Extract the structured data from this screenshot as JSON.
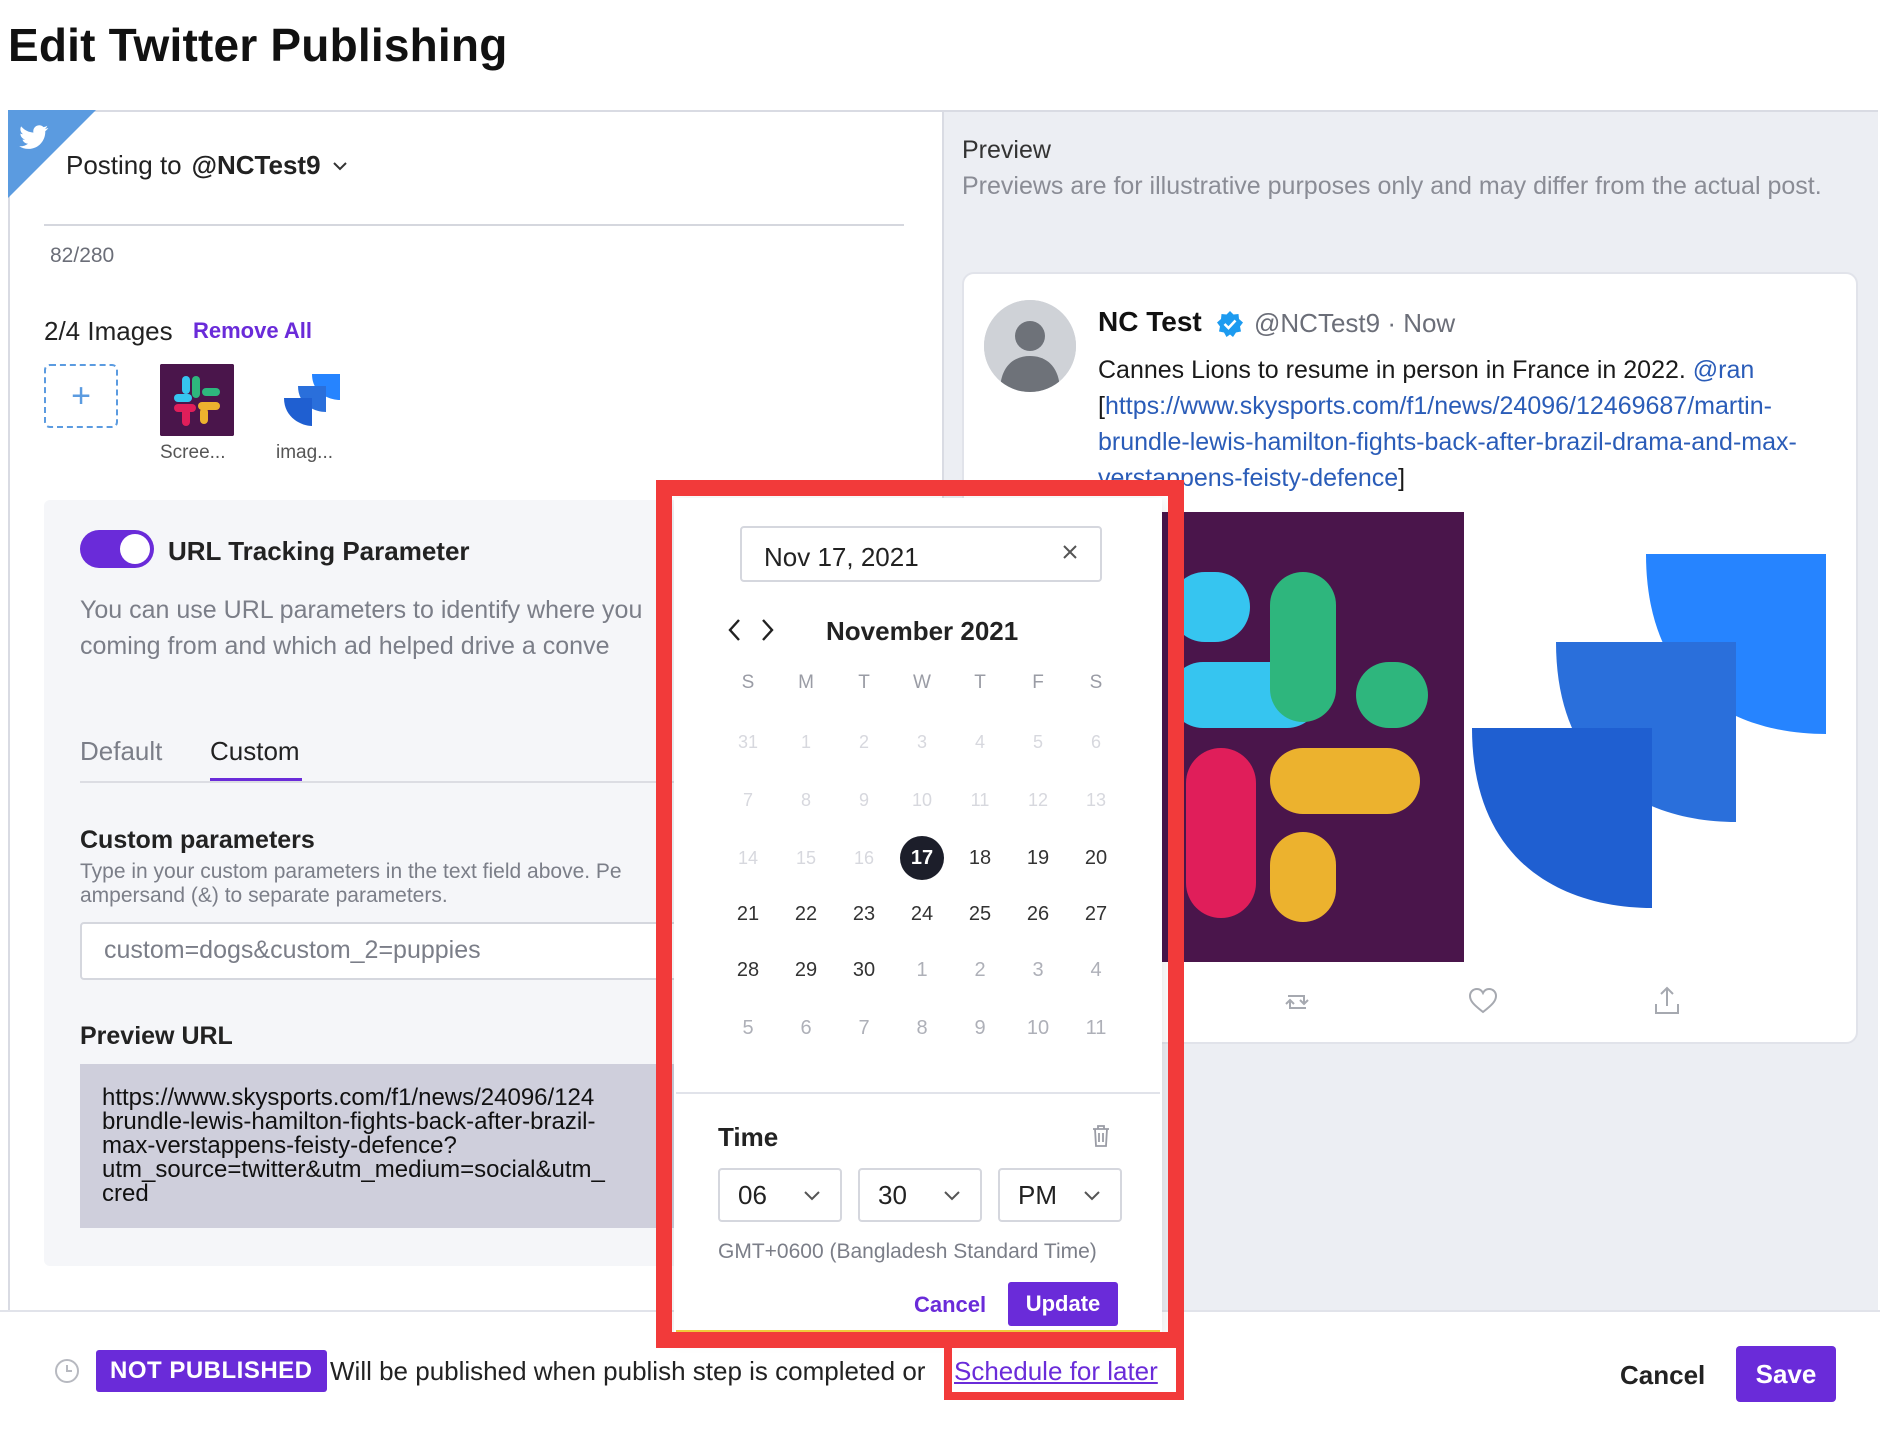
{
  "page": {
    "title": "Edit Twitter Publishing"
  },
  "editor": {
    "posting_to_label": "Posting to",
    "account": "@NCTest9",
    "char_count": "82/280",
    "images_label": "2/4 Images",
    "remove_all": "Remove All",
    "images": [
      {
        "caption": "Scree..."
      },
      {
        "caption": "imag..."
      }
    ]
  },
  "tracking": {
    "title": "URL Tracking Parameter",
    "description": "You can use URL parameters to identify where you coming from and which ad helped drive a conve",
    "tabs": [
      "Default",
      "Custom"
    ],
    "active_tab": "Custom",
    "custom_params_title": "Custom parameters",
    "custom_params_help": "Type in your custom parameters in the text field above. Pe ampersand (&) to separate parameters.",
    "custom_input_value": "custom=dogs&custom_2=puppies",
    "preview_url_title": "Preview URL",
    "preview_url": "https://www.skysports.com/f1/news/24096/124\nbrundle-lewis-hamilton-fights-back-after-brazil-\nmax-verstappens-feisty-defence?\nutm_source=twitter&utm_medium=social&utm_\ncred",
    "toggle_on": true
  },
  "preview": {
    "title": "Preview",
    "subtitle": "Previews are for illustrative purposes only and may differ from the actual post.",
    "tweet": {
      "name": "NC Test",
      "handle": "@NCTest9 · Now",
      "text_plain": "Cannes Lions to resume in person in France in 2022. ",
      "mention": "@ran",
      "link_open": "[",
      "link": "https://www.skysports.com/f1/news/24096/12469687/martin-brundle-lewis-hamilton-fights-back-after-brazil-drama-and-max-verstappens-feisty-defence",
      "link_close": "]"
    }
  },
  "datepicker": {
    "date_value": "Nov 17, 2021",
    "month_label": "November 2021",
    "weekdays": [
      "S",
      "M",
      "T",
      "W",
      "T",
      "F",
      "S"
    ],
    "weeks": [
      [
        "31",
        "1",
        "2",
        "3",
        "4",
        "5",
        "6"
      ],
      [
        "7",
        "8",
        "9",
        "10",
        "11",
        "12",
        "13"
      ],
      [
        "14",
        "15",
        "16",
        "17",
        "18",
        "19",
        "20"
      ],
      [
        "21",
        "22",
        "23",
        "24",
        "25",
        "26",
        "27"
      ],
      [
        "28",
        "29",
        "30",
        "1",
        "2",
        "3",
        "4"
      ],
      [
        "5",
        "6",
        "7",
        "8",
        "9",
        "10",
        "11"
      ]
    ],
    "selected_day": "17",
    "time_label": "Time",
    "hour": "06",
    "minute": "30",
    "ampm": "PM",
    "timezone": "GMT+0600 (Bangladesh Standard Time)",
    "cancel": "Cancel",
    "update": "Update"
  },
  "footer": {
    "status_badge": "NOT PUBLISHED",
    "publish_note": "Will be published when publish step is completed or",
    "schedule_link": "Schedule for later",
    "cancel": "Cancel",
    "save": "Save"
  },
  "colors": {
    "accent": "#6a2bd9",
    "twitter_blue": "#5b9be0",
    "highlight": "#f23a3a",
    "selected_day": "#1c1e2a"
  }
}
